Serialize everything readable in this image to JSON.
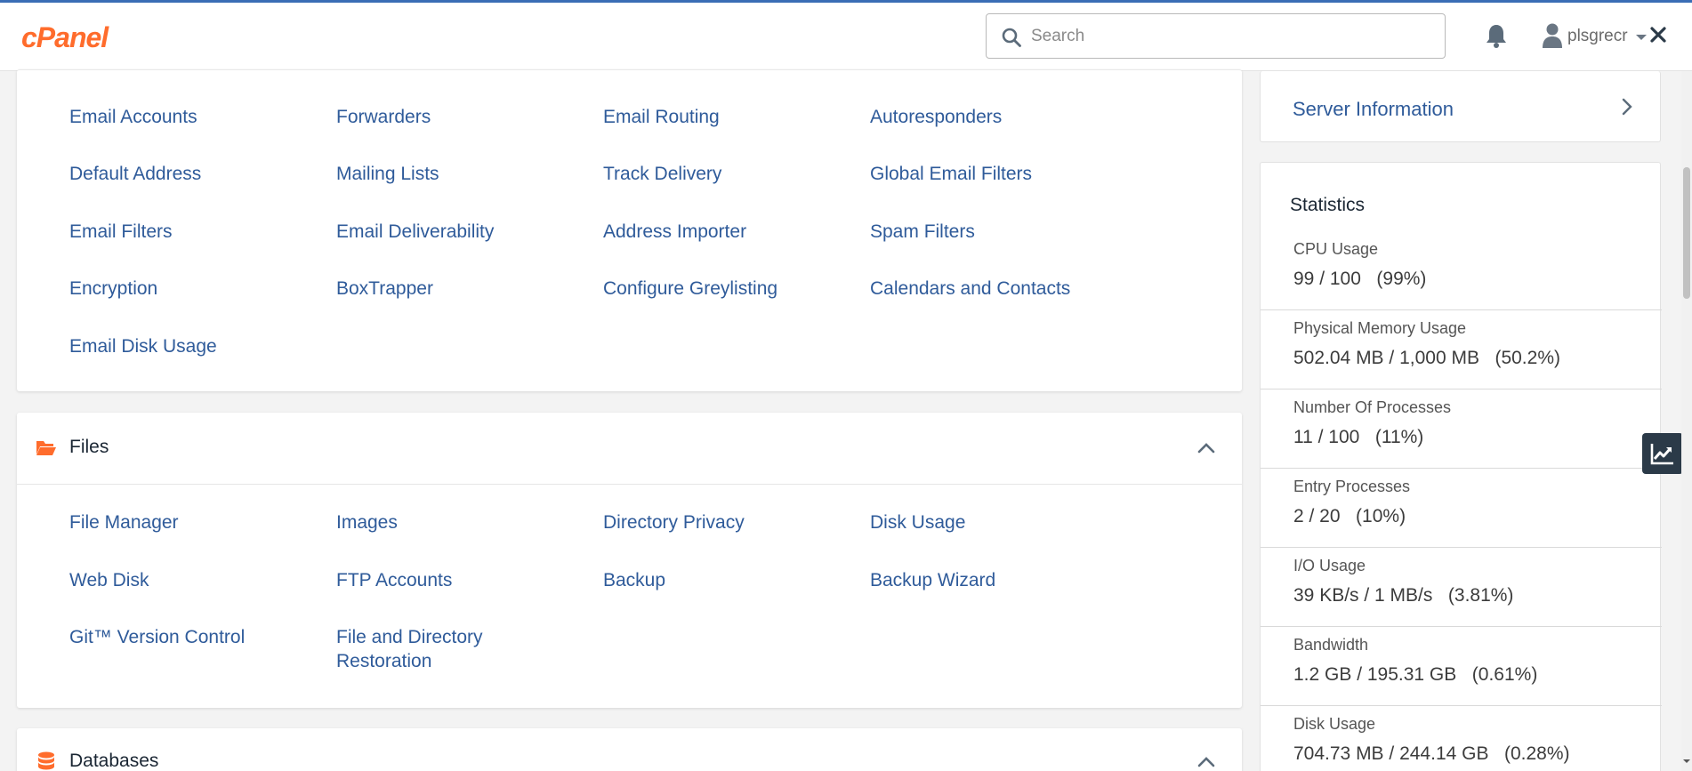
{
  "header": {
    "logo_text": "cPanel",
    "search_placeholder": "Search",
    "username": "plsgrecr"
  },
  "colors": {
    "brand_orange": "#ff6c2c",
    "link_blue": "#2f5b9a",
    "dark": "#293a4a"
  },
  "email_section": {
    "items": [
      [
        "Email Accounts",
        "Forwarders",
        "Email Routing",
        "Autoresponders"
      ],
      [
        "Default Address",
        "Mailing Lists",
        "Track Delivery",
        "Global Email Filters"
      ],
      [
        "Email Filters",
        "Email Deliverability",
        "Address Importer",
        "Spam Filters"
      ],
      [
        "Encryption",
        "BoxTrapper",
        "Configure Greylisting",
        "Calendars and Contacts"
      ],
      [
        "Email Disk Usage"
      ]
    ]
  },
  "files_section": {
    "title": "Files",
    "icon": "folder-open-icon",
    "items": [
      [
        "File Manager",
        "Images",
        "Directory Privacy",
        "Disk Usage"
      ],
      [
        "Web Disk",
        "FTP Accounts",
        "Backup",
        "Backup Wizard"
      ],
      [
        "Git™ Version Control",
        "File and Directory\nRestoration"
      ]
    ]
  },
  "databases_section": {
    "title": "Databases",
    "icon": "database-icon"
  },
  "sidebar": {
    "server_info_label": "Server Information",
    "stats_title": "Statistics",
    "stats": [
      {
        "name": "CPU Usage",
        "value": "99 / 100   (99%)"
      },
      {
        "name": "Physical Memory Usage",
        "value": "502.04 MB / 1,000 MB   (50.2%)"
      },
      {
        "name": "Number Of Processes",
        "value": "11 / 100   (11%)"
      },
      {
        "name": "Entry Processes",
        "value": "2 / 20   (10%)"
      },
      {
        "name": "I/O Usage",
        "value": "39 KB/s / 1 MB/s   (3.81%)"
      },
      {
        "name": "Bandwidth",
        "value": "1.2 GB / 195.31 GB   (0.61%)"
      },
      {
        "name": "Disk Usage",
        "value": "704.73 MB / 244.14 GB   (0.28%)"
      }
    ]
  }
}
